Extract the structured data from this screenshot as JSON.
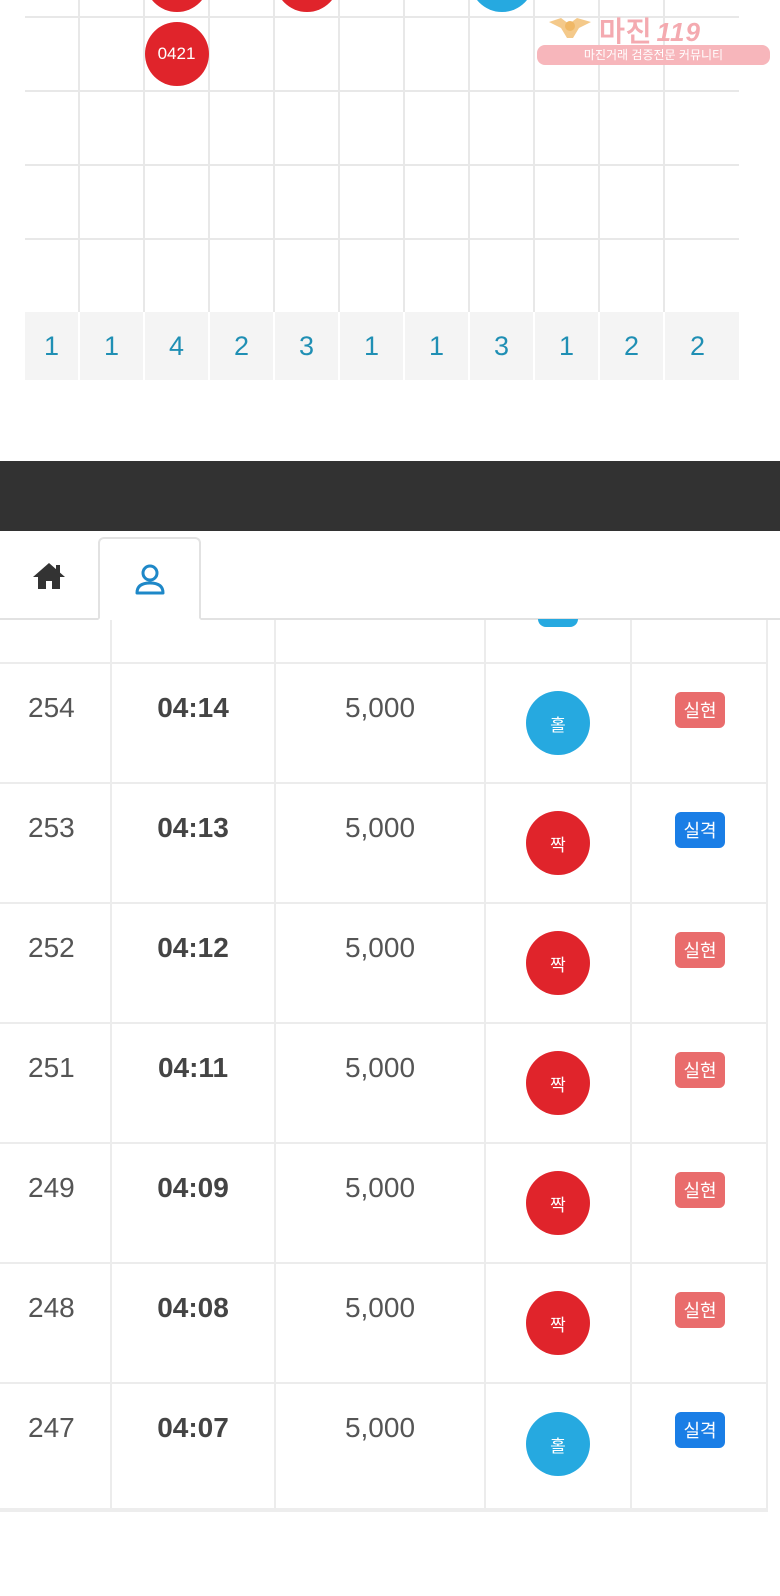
{
  "watermark": {
    "title": "마진",
    "title_suffix": "119",
    "subtitle": "마진거래 검증전문 커뮤니티"
  },
  "road_grid": {
    "top_row": [
      {
        "col": 2,
        "color": "red",
        "label": ""
      },
      {
        "col": 4,
        "color": "red",
        "label": ""
      },
      {
        "col": 7,
        "color": "blue",
        "label": ""
      }
    ],
    "second_row": [
      {
        "col": 2,
        "color": "red",
        "label": "0421"
      }
    ],
    "counts": [
      "1",
      "1",
      "4",
      "2",
      "3",
      "1",
      "1",
      "3",
      "1",
      "2",
      "2"
    ]
  },
  "tabs": {
    "home_icon": "home-icon",
    "user_icon": "user-icon"
  },
  "history": [
    {
      "no": "254",
      "time": "04:14",
      "amount": "5,000",
      "pick": "홀",
      "pick_color": "blue",
      "result": "실현",
      "result_type": "win"
    },
    {
      "no": "253",
      "time": "04:13",
      "amount": "5,000",
      "pick": "짝",
      "pick_color": "red",
      "result": "실격",
      "result_type": "lose"
    },
    {
      "no": "252",
      "time": "04:12",
      "amount": "5,000",
      "pick": "짝",
      "pick_color": "red",
      "result": "실현",
      "result_type": "win"
    },
    {
      "no": "251",
      "time": "04:11",
      "amount": "5,000",
      "pick": "짝",
      "pick_color": "red",
      "result": "실현",
      "result_type": "win"
    },
    {
      "no": "249",
      "time": "04:09",
      "amount": "5,000",
      "pick": "짝",
      "pick_color": "red",
      "result": "실현",
      "result_type": "win"
    },
    {
      "no": "248",
      "time": "04:08",
      "amount": "5,000",
      "pick": "짝",
      "pick_color": "red",
      "result": "실현",
      "result_type": "win"
    },
    {
      "no": "247",
      "time": "04:07",
      "amount": "5,000",
      "pick": "홀",
      "pick_color": "blue",
      "result": "실격",
      "result_type": "lose"
    }
  ],
  "colors": {
    "red": "#e0242b",
    "blue": "#26a9e0",
    "win": "#e96c6c",
    "lose": "#1a7ee6",
    "count_text": "#1f8fb4"
  }
}
